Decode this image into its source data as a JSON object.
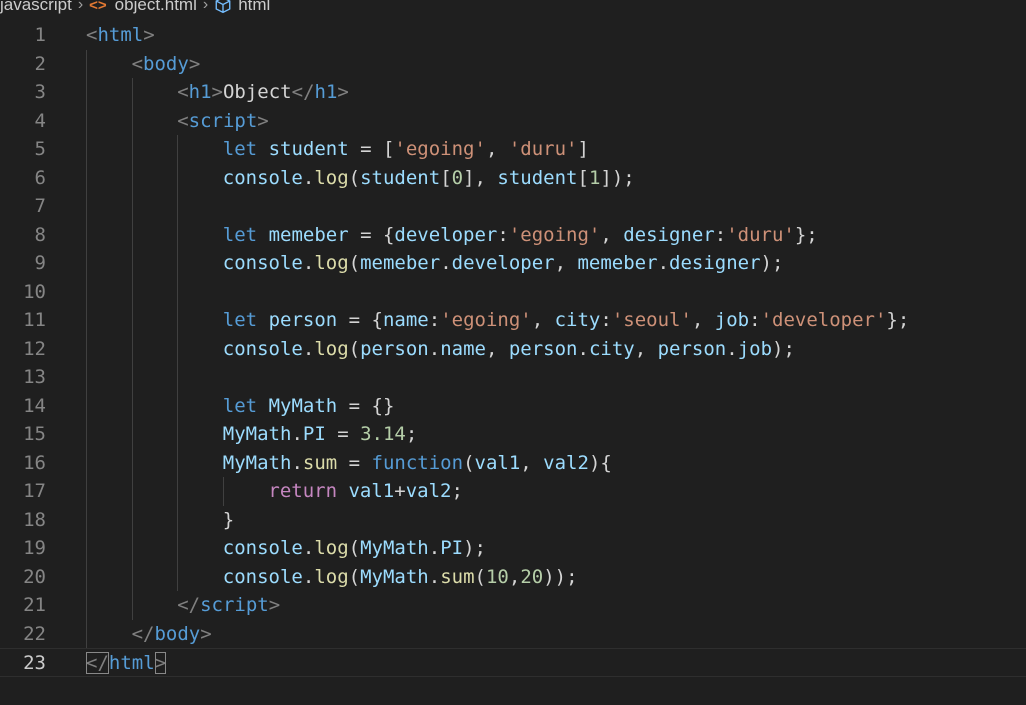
{
  "breadcrumb": {
    "items": [
      "javascript",
      "object.html",
      "html"
    ]
  },
  "editor": {
    "current_line": 23,
    "lines": [
      {
        "n": "1",
        "indent": 0,
        "tokens": [
          [
            "t-punct",
            "<"
          ],
          [
            "t-tag",
            "html"
          ],
          [
            "t-punct",
            ">"
          ]
        ]
      },
      {
        "n": "2",
        "indent": 1,
        "tokens": [
          [
            "t-punct",
            "<"
          ],
          [
            "t-tag",
            "body"
          ],
          [
            "t-punct",
            ">"
          ]
        ]
      },
      {
        "n": "3",
        "indent": 2,
        "tokens": [
          [
            "t-punct",
            "<"
          ],
          [
            "t-tag",
            "h1"
          ],
          [
            "t-punct",
            ">"
          ],
          [
            "t-text",
            "Object"
          ],
          [
            "t-punct",
            "</"
          ],
          [
            "t-tag",
            "h1"
          ],
          [
            "t-punct",
            ">"
          ]
        ]
      },
      {
        "n": "4",
        "indent": 2,
        "tokens": [
          [
            "t-punct",
            "<"
          ],
          [
            "t-tag",
            "script"
          ],
          [
            "t-punct",
            ">"
          ]
        ]
      },
      {
        "n": "5",
        "indent": 3,
        "tokens": [
          [
            "t-key",
            "let"
          ],
          [
            "t-op",
            " "
          ],
          [
            "t-var",
            "student"
          ],
          [
            "t-op",
            " = ["
          ],
          [
            "t-str",
            "'egoing'"
          ],
          [
            "t-op",
            ", "
          ],
          [
            "t-str",
            "'duru'"
          ],
          [
            "t-op",
            "]"
          ]
        ]
      },
      {
        "n": "6",
        "indent": 3,
        "tokens": [
          [
            "t-var",
            "console"
          ],
          [
            "t-op",
            "."
          ],
          [
            "t-fn",
            "log"
          ],
          [
            "t-op",
            "("
          ],
          [
            "t-var",
            "student"
          ],
          [
            "t-op",
            "["
          ],
          [
            "t-num",
            "0"
          ],
          [
            "t-op",
            "], "
          ],
          [
            "t-var",
            "student"
          ],
          [
            "t-op",
            "["
          ],
          [
            "t-num",
            "1"
          ],
          [
            "t-op",
            "]);"
          ]
        ]
      },
      {
        "n": "7",
        "indent": 3,
        "tokens": []
      },
      {
        "n": "8",
        "indent": 3,
        "tokens": [
          [
            "t-key",
            "let"
          ],
          [
            "t-op",
            " "
          ],
          [
            "t-var",
            "memeber"
          ],
          [
            "t-op",
            " = {"
          ],
          [
            "t-var",
            "developer"
          ],
          [
            "t-op",
            ":"
          ],
          [
            "t-str",
            "'egoing'"
          ],
          [
            "t-op",
            ", "
          ],
          [
            "t-var",
            "designer"
          ],
          [
            "t-op",
            ":"
          ],
          [
            "t-str",
            "'duru'"
          ],
          [
            "t-op",
            "};"
          ]
        ]
      },
      {
        "n": "9",
        "indent": 3,
        "tokens": [
          [
            "t-var",
            "console"
          ],
          [
            "t-op",
            "."
          ],
          [
            "t-fn",
            "log"
          ],
          [
            "t-op",
            "("
          ],
          [
            "t-var",
            "memeber"
          ],
          [
            "t-op",
            "."
          ],
          [
            "t-var",
            "developer"
          ],
          [
            "t-op",
            ", "
          ],
          [
            "t-var",
            "memeber"
          ],
          [
            "t-op",
            "."
          ],
          [
            "t-var",
            "designer"
          ],
          [
            "t-op",
            ");"
          ]
        ]
      },
      {
        "n": "10",
        "indent": 3,
        "tokens": []
      },
      {
        "n": "11",
        "indent": 3,
        "tokens": [
          [
            "t-key",
            "let"
          ],
          [
            "t-op",
            " "
          ],
          [
            "t-var",
            "person"
          ],
          [
            "t-op",
            " = {"
          ],
          [
            "t-var",
            "name"
          ],
          [
            "t-op",
            ":"
          ],
          [
            "t-str",
            "'egoing'"
          ],
          [
            "t-op",
            ", "
          ],
          [
            "t-var",
            "city"
          ],
          [
            "t-op",
            ":"
          ],
          [
            "t-str",
            "'seoul'"
          ],
          [
            "t-op",
            ", "
          ],
          [
            "t-var",
            "job"
          ],
          [
            "t-op",
            ":"
          ],
          [
            "t-str",
            "'developer'"
          ],
          [
            "t-op",
            "};"
          ]
        ]
      },
      {
        "n": "12",
        "indent": 3,
        "tokens": [
          [
            "t-var",
            "console"
          ],
          [
            "t-op",
            "."
          ],
          [
            "t-fn",
            "log"
          ],
          [
            "t-op",
            "("
          ],
          [
            "t-var",
            "person"
          ],
          [
            "t-op",
            "."
          ],
          [
            "t-var",
            "name"
          ],
          [
            "t-op",
            ", "
          ],
          [
            "t-var",
            "person"
          ],
          [
            "t-op",
            "."
          ],
          [
            "t-var",
            "city"
          ],
          [
            "t-op",
            ", "
          ],
          [
            "t-var",
            "person"
          ],
          [
            "t-op",
            "."
          ],
          [
            "t-var",
            "job"
          ],
          [
            "t-op",
            ");"
          ]
        ]
      },
      {
        "n": "13",
        "indent": 3,
        "tokens": []
      },
      {
        "n": "14",
        "indent": 3,
        "tokens": [
          [
            "t-key",
            "let"
          ],
          [
            "t-op",
            " "
          ],
          [
            "t-var",
            "MyMath"
          ],
          [
            "t-op",
            " = {}"
          ]
        ]
      },
      {
        "n": "15",
        "indent": 3,
        "tokens": [
          [
            "t-var",
            "MyMath"
          ],
          [
            "t-op",
            "."
          ],
          [
            "t-var",
            "PI"
          ],
          [
            "t-op",
            " = "
          ],
          [
            "t-num",
            "3.14"
          ],
          [
            "t-op",
            ";"
          ]
        ]
      },
      {
        "n": "16",
        "indent": 3,
        "tokens": [
          [
            "t-var",
            "MyMath"
          ],
          [
            "t-op",
            "."
          ],
          [
            "t-fn",
            "sum"
          ],
          [
            "t-op",
            " = "
          ],
          [
            "t-key",
            "function"
          ],
          [
            "t-op",
            "("
          ],
          [
            "t-var",
            "val1"
          ],
          [
            "t-op",
            ", "
          ],
          [
            "t-var",
            "val2"
          ],
          [
            "t-op",
            "){"
          ]
        ]
      },
      {
        "n": "17",
        "indent": 4,
        "tokens": [
          [
            "t-ret",
            "return"
          ],
          [
            "t-op",
            " "
          ],
          [
            "t-var",
            "val1"
          ],
          [
            "t-op",
            "+"
          ],
          [
            "t-var",
            "val2"
          ],
          [
            "t-op",
            ";"
          ]
        ]
      },
      {
        "n": "18",
        "indent": 3,
        "tokens": [
          [
            "t-op",
            "}"
          ]
        ]
      },
      {
        "n": "19",
        "indent": 3,
        "tokens": [
          [
            "t-var",
            "console"
          ],
          [
            "t-op",
            "."
          ],
          [
            "t-fn",
            "log"
          ],
          [
            "t-op",
            "("
          ],
          [
            "t-var",
            "MyMath"
          ],
          [
            "t-op",
            "."
          ],
          [
            "t-var",
            "PI"
          ],
          [
            "t-op",
            ");"
          ]
        ]
      },
      {
        "n": "20",
        "indent": 3,
        "tokens": [
          [
            "t-var",
            "console"
          ],
          [
            "t-op",
            "."
          ],
          [
            "t-fn",
            "log"
          ],
          [
            "t-op",
            "("
          ],
          [
            "t-var",
            "MyMath"
          ],
          [
            "t-op",
            "."
          ],
          [
            "t-fn",
            "sum"
          ],
          [
            "t-op",
            "("
          ],
          [
            "t-num",
            "10"
          ],
          [
            "t-op",
            ","
          ],
          [
            "t-num",
            "20"
          ],
          [
            "t-op",
            "));"
          ]
        ]
      },
      {
        "n": "21",
        "indent": 2,
        "tokens": [
          [
            "t-punct",
            "</"
          ],
          [
            "t-tag",
            "script"
          ],
          [
            "t-punct",
            ">"
          ]
        ]
      },
      {
        "n": "22",
        "indent": 1,
        "tokens": [
          [
            "t-punct",
            "</"
          ],
          [
            "t-tag",
            "body"
          ],
          [
            "t-punct",
            ">"
          ]
        ]
      },
      {
        "n": "23",
        "indent": 0,
        "tokens": [
          [
            "t-punct",
            "</"
          ],
          [
            "t-tag",
            "html"
          ],
          [
            "t-punct",
            ">"
          ]
        ]
      }
    ]
  }
}
